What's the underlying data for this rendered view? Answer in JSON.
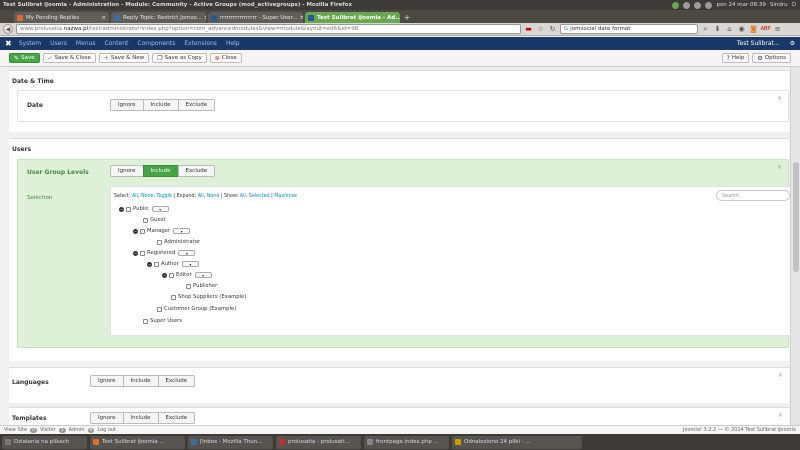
{
  "os": {
    "window_title": "Test Sulibrat iJoomla - Administration - Module: Community - Active Groups (mod_activegroups) - Mozilla Firefox",
    "clock": "pon 24 mar 08:39",
    "user": "Sindru",
    "adblock": "ABP"
  },
  "tabs": [
    {
      "label": "My Pending Replies",
      "color": "#e46a2b"
    },
    {
      "label": "Reply Topic: Restrict Jomso...",
      "color": "#3a6ea5"
    },
    {
      "label": "rrrrrrrrrrrrrrrrr - Super User...",
      "color": "#2b5797"
    },
    {
      "label": "Test Sulibrat iJoomla - Ad...",
      "color": "#2b5797",
      "active": true
    }
  ],
  "nav": {
    "url_prefix": "www.prolusatia.",
    "url_host": "nazwa.pl",
    "url_rest": "/test/administrator/index.php?option=com_advancedmodules&view=module&layout=edit&id=98",
    "search_value": "jomsocial date format"
  },
  "joomla_menu": {
    "items": [
      "System",
      "Users",
      "Menus",
      "Content",
      "Components",
      "Extensions",
      "Help"
    ],
    "site_link": "Test Sulibrat...",
    "gear": "⚙"
  },
  "toolbar": {
    "save": "Save",
    "save_close": "Save & Close",
    "save_new": "Save & New",
    "save_copy": "Save as Copy",
    "close": "Close",
    "help": "Help",
    "options": "Options"
  },
  "sections": {
    "datetime": {
      "heading": "Date & Time",
      "row_label": "Date",
      "buttons": [
        "Ignore",
        "Include",
        "Exclude"
      ]
    },
    "users": {
      "heading": "Users",
      "row_label": "User Group Levels",
      "buttons": [
        "Ignore",
        "Include",
        "Exclude"
      ],
      "active_button": "Include",
      "selection_label": "Selection",
      "tools": {
        "select_label": "Select:",
        "all": "All",
        "none": "None",
        "toggle": "Toggle",
        "expand_label": "Expand:",
        "expand_all": "All",
        "expand_none": "None",
        "show_label": "Show:",
        "show_all": "All",
        "show_selected": "Selected",
        "maximize": "Maximize"
      },
      "search_placeholder": "Search",
      "tree": [
        {
          "label": "Public",
          "expander": true,
          "dropdown": true
        },
        {
          "label": "Guest"
        },
        {
          "label": "Manager",
          "expander": true,
          "dropdown": true
        },
        {
          "label": "Administrator"
        },
        {
          "label": "Registered",
          "expander": true,
          "dropdown": true
        },
        {
          "label": "Author",
          "expander": true,
          "dropdown": true
        },
        {
          "label": "Editor",
          "expander": true,
          "dropdown": true
        },
        {
          "label": "Publisher"
        },
        {
          "label": "Shop Suppliers (Example)"
        },
        {
          "label": "Customer Group (Example)"
        },
        {
          "label": "Super Users"
        }
      ]
    },
    "languages": {
      "heading": "Languages",
      "buttons": [
        "Ignore",
        "Include",
        "Exclude"
      ]
    },
    "templates": {
      "heading": "Templates",
      "buttons": [
        "Ignore",
        "Include",
        "Exclude"
      ]
    }
  },
  "statusbar": {
    "view_site": "View Site",
    "visitors_count": "0",
    "visitor_label": "Visitor",
    "admin_count": "1",
    "admin_label": "Admin",
    "messages_count": "0",
    "logout": "Log out",
    "copyright": "Joomla! 3.2.2 — © 2014 Test Sulibrat iJoomla"
  },
  "taskbar": [
    {
      "label": "Działania na plikach",
      "color": "#777"
    },
    {
      "label": "Test Sulibrat iJoomla ...",
      "color": "#e46a2b"
    },
    {
      "label": "[Inbox - Mozilla Thun...",
      "color": "#3a6ea5"
    },
    {
      "label": "prolusatia - prolusati...",
      "color": "#c03030"
    },
    {
      "label": "frontpage.index.php ...",
      "color": "#888"
    },
    {
      "label": "Odnaleziono 24 pliki - ...",
      "color": "#cc9900"
    }
  ]
}
